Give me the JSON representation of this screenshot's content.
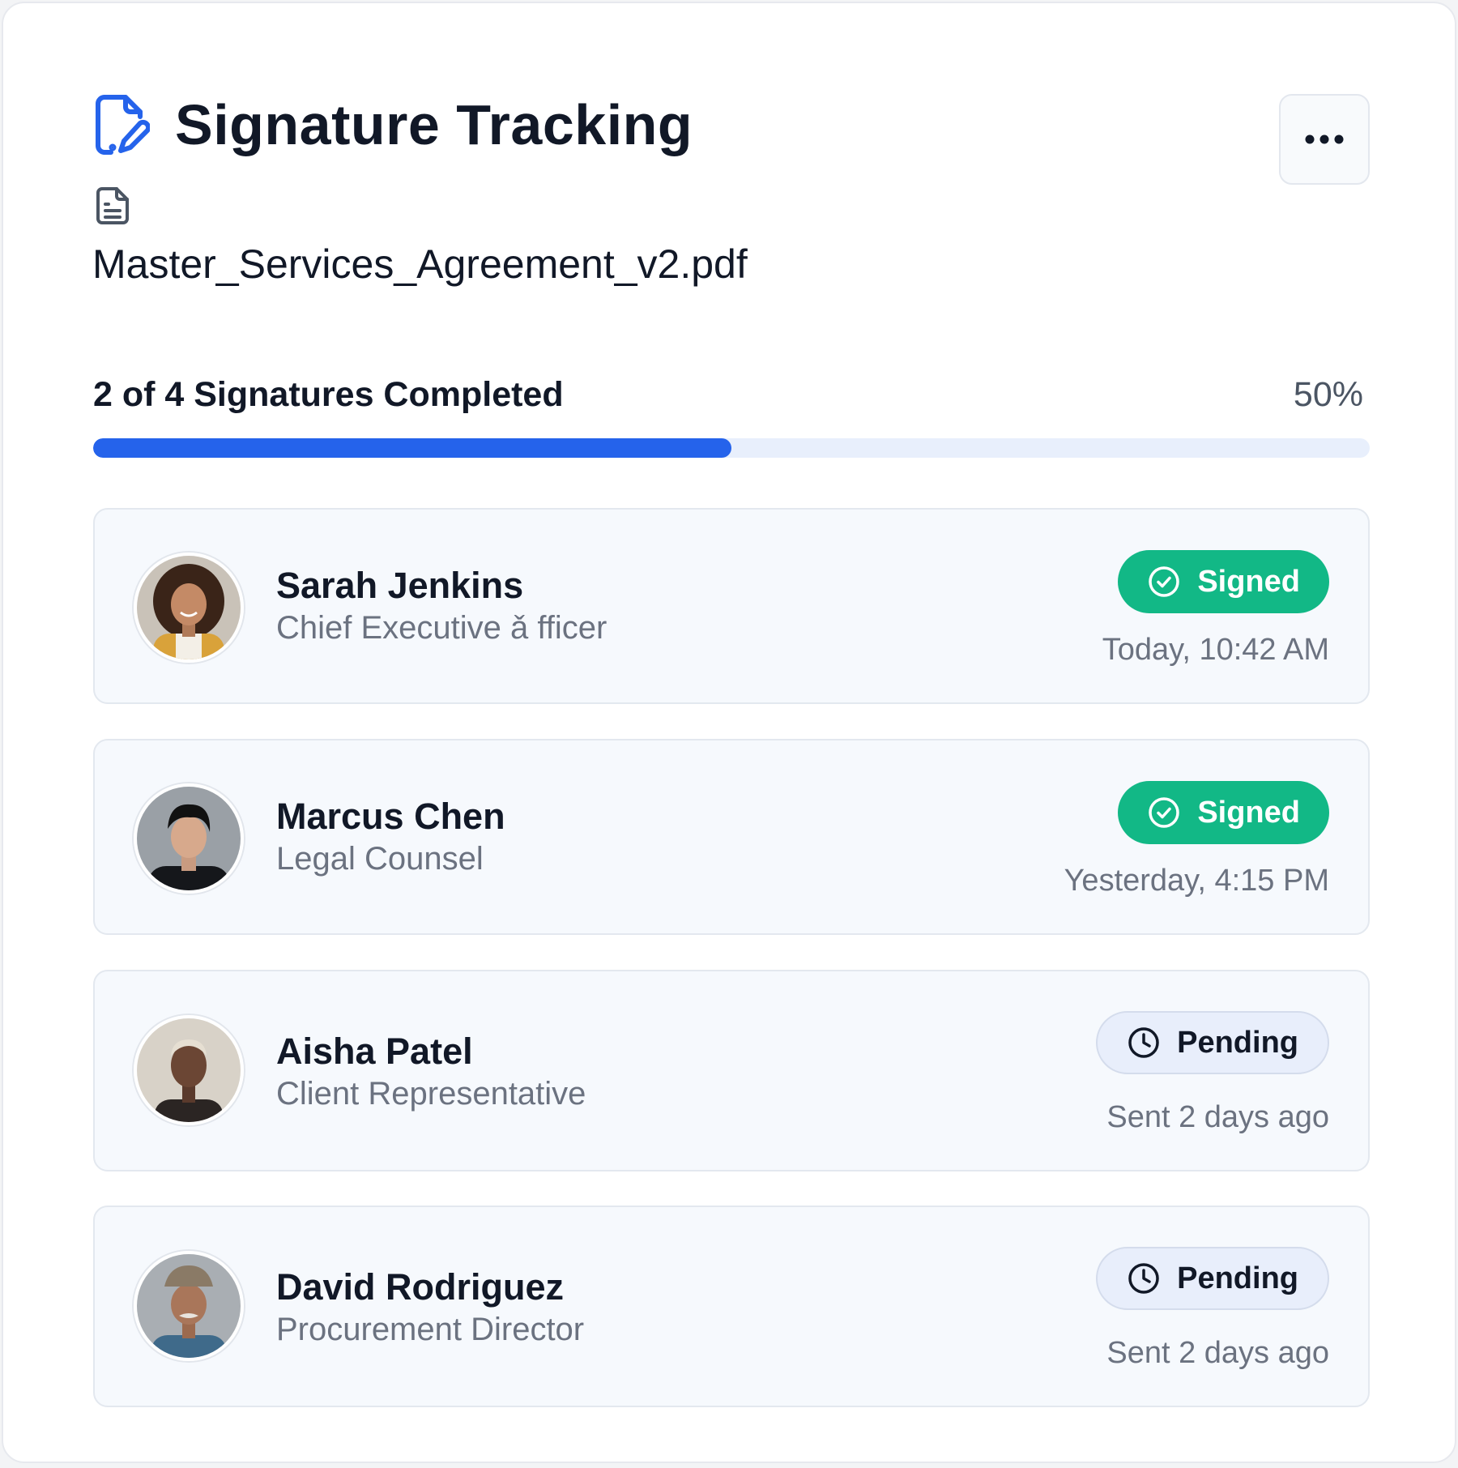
{
  "header": {
    "title": "Signature Tracking",
    "file_name": "Master_Services_Agreement_v2.pdf",
    "title_icon": "document-signature-icon",
    "file_icon": "document-icon",
    "more_icon": "more-horizontal-icon"
  },
  "progress": {
    "label": "2 of 4 Signatures Completed",
    "percent_label": "50%",
    "value": 0.5
  },
  "signers": [
    {
      "name": "Sarah Jenkins",
      "role": "Chief Executive ǎ fficer",
      "status": "Signed",
      "status_icon": "check-circle-icon",
      "time": "Today, 10:42 AM"
    },
    {
      "name": "Marcus Chen",
      "role": "Legal Counsel",
      "status": "Signed",
      "status_icon": "check-circle-icon",
      "time": "Yesterday, 4:15 PM"
    },
    {
      "name": "Aisha Patel",
      "role": "Client Representative",
      "status": "Pending",
      "status_icon": "clock-icon",
      "time": "Sent 2 days ago"
    },
    {
      "name": "David Rodriguez",
      "role": "Procurement Director",
      "status": "Pending",
      "status_icon": "clock-icon",
      "time": "Sent 2 days ago"
    }
  ],
  "colors": {
    "accent": "#2563eb",
    "signed": "#12b886",
    "pending_bg": "#e8eefb",
    "text_primary": "#111827",
    "text_secondary": "#6b7280"
  }
}
